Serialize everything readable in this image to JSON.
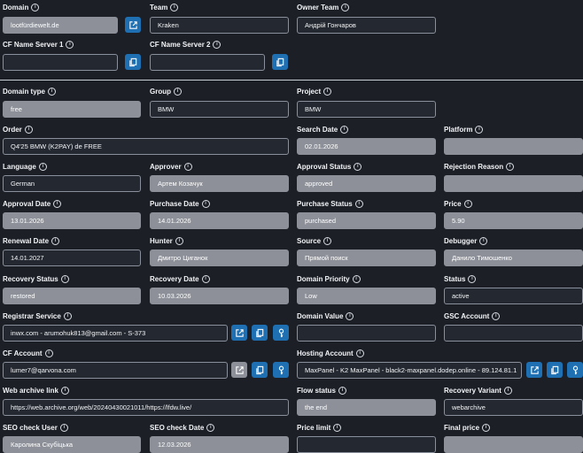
{
  "labels": {
    "domain": "Domain",
    "team": "Team",
    "owner_team": "Owner Team",
    "cf_ns1": "CF Name Server 1",
    "cf_ns2": "CF Name Server 2",
    "domain_type": "Domain type",
    "group": "Group",
    "project": "Project",
    "order": "Order",
    "search_date": "Search Date",
    "platform": "Platform",
    "language": "Language",
    "approver": "Approver",
    "approval_status": "Approval Status",
    "rejection_reason": "Rejection Reason",
    "approval_date": "Approval Date",
    "purchase_date": "Purchase Date",
    "purchase_status": "Purchase Status",
    "price": "Price",
    "renewal_date": "Renewal Date",
    "hunter": "Hunter",
    "source": "Source",
    "debugger": "Debugger",
    "recovery_status": "Recovery Status",
    "recovery_date": "Recovery Date",
    "domain_priority": "Domain Priority",
    "status": "Status",
    "registrar_service": "Registrar Service",
    "domain_value": "Domain Value",
    "gsc_account": "GSC Account",
    "cf_account": "CF Account",
    "hosting_account": "Hosting Account",
    "web_archive_link": "Web archive link",
    "flow_status": "Flow status",
    "recovery_variant": "Recovery Variant",
    "seo_check_user": "SEO check User",
    "seo_check_date": "SEO check Date",
    "price_limit": "Price limit",
    "final_price": "Final price"
  },
  "values": {
    "domain": "lootfürdiewelt.de",
    "team": "Kraken",
    "owner_team": "Андрій Гончаров",
    "cf_ns1": "",
    "cf_ns2": "",
    "domain_type": "free",
    "group": "BMW",
    "project": "BMW",
    "order": "Q4'25 BMW (K2PAY) de FREE",
    "search_date": "02.01.2026",
    "platform": "",
    "language": "German",
    "approver": "Артем Козачук",
    "approval_status": "approved",
    "rejection_reason": "",
    "approval_date": "13.01.2026",
    "purchase_date": "14.01.2026",
    "purchase_status": "purchased",
    "price": "5.90",
    "renewal_date": "14.01.2027",
    "hunter": "Дмитро Циганок",
    "source": "Прямой поиск",
    "debugger": "Данило Тимошенко",
    "recovery_status": "restored",
    "recovery_date": "10.03.2026",
    "domain_priority": "Low",
    "status": "active",
    "registrar_service": "inwx.com - arumohuk813@gmail.com - S-373",
    "domain_value": "",
    "gsc_account": "",
    "cf_account": "lumer7@qarvona.com",
    "hosting_account": "MaxPanel - K2 MaxPanel - black2-maxpanel.dodep.online - 89.124.81.1",
    "web_archive_link": "https://web.archive.org/web/20240430021011/https://lfdw.live/",
    "flow_status": "the end",
    "recovery_variant": "webarchive",
    "seo_check_user": "Каролина Скубіцька",
    "seo_check_date": "12.03.2026",
    "price_limit": "",
    "final_price": ""
  },
  "icons": {
    "info": "i",
    "external_link": "external-link-icon",
    "copy": "copy-icon",
    "key": "key-icon"
  },
  "colors": {
    "background": "#1c1f26",
    "readonly_field": "#8d9098",
    "accent_button": "#1f6fb3"
  }
}
